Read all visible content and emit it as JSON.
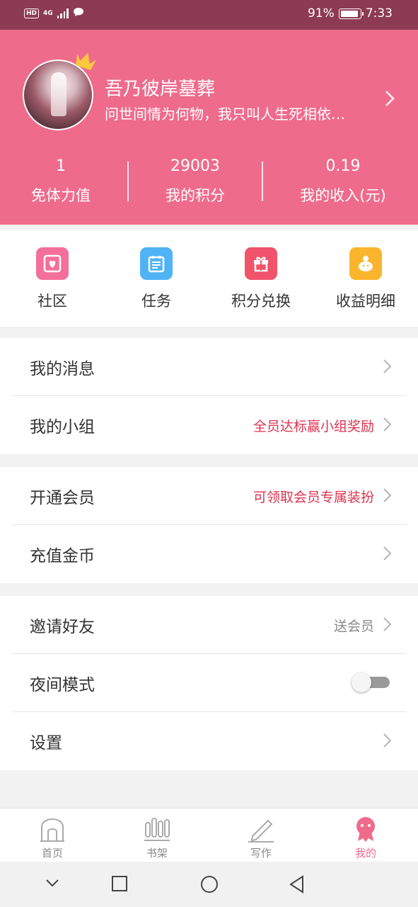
{
  "status_bar": {
    "hd": "HD",
    "network": "4G",
    "battery": "91%",
    "time": "7:33"
  },
  "profile": {
    "name": "吾乃彼岸墓葬",
    "motto": "问世间情为何物，我只叫人生死相依…"
  },
  "stats": [
    {
      "value": "1",
      "label": "免体力值"
    },
    {
      "value": "29003",
      "label": "我的积分"
    },
    {
      "value": "0.19",
      "label": "我的收入(元)"
    }
  ],
  "shortcuts": [
    {
      "label": "社区",
      "icon": "community-icon",
      "color": "#f46f9a"
    },
    {
      "label": "任务",
      "icon": "task-icon",
      "color": "#4fb3f6"
    },
    {
      "label": "积分兑换",
      "icon": "gift-icon",
      "color": "#f0536b"
    },
    {
      "label": "收益明细",
      "icon": "piggy-bank-icon",
      "color": "#fbb52d"
    }
  ],
  "menu": {
    "messages": {
      "title": "我的消息"
    },
    "group": {
      "title": "我的小组",
      "hint": "全员达标赢小组奖励"
    },
    "vip": {
      "title": "开通会员",
      "hint": "可领取会员专属装扮"
    },
    "recharge": {
      "title": "充值金币"
    },
    "invite": {
      "title": "邀请好友",
      "hint": "送会员"
    },
    "night_mode": {
      "title": "夜间模式",
      "enabled": false
    },
    "settings": {
      "title": "设置"
    }
  },
  "tabs": [
    {
      "label": "首页",
      "active": false
    },
    {
      "label": "书架",
      "active": false
    },
    {
      "label": "写作",
      "active": false
    },
    {
      "label": "我的",
      "active": true
    }
  ],
  "colors": {
    "brand": "#ef6b8b",
    "status_bar": "#8c3b52",
    "hint_red": "#e0334f"
  }
}
